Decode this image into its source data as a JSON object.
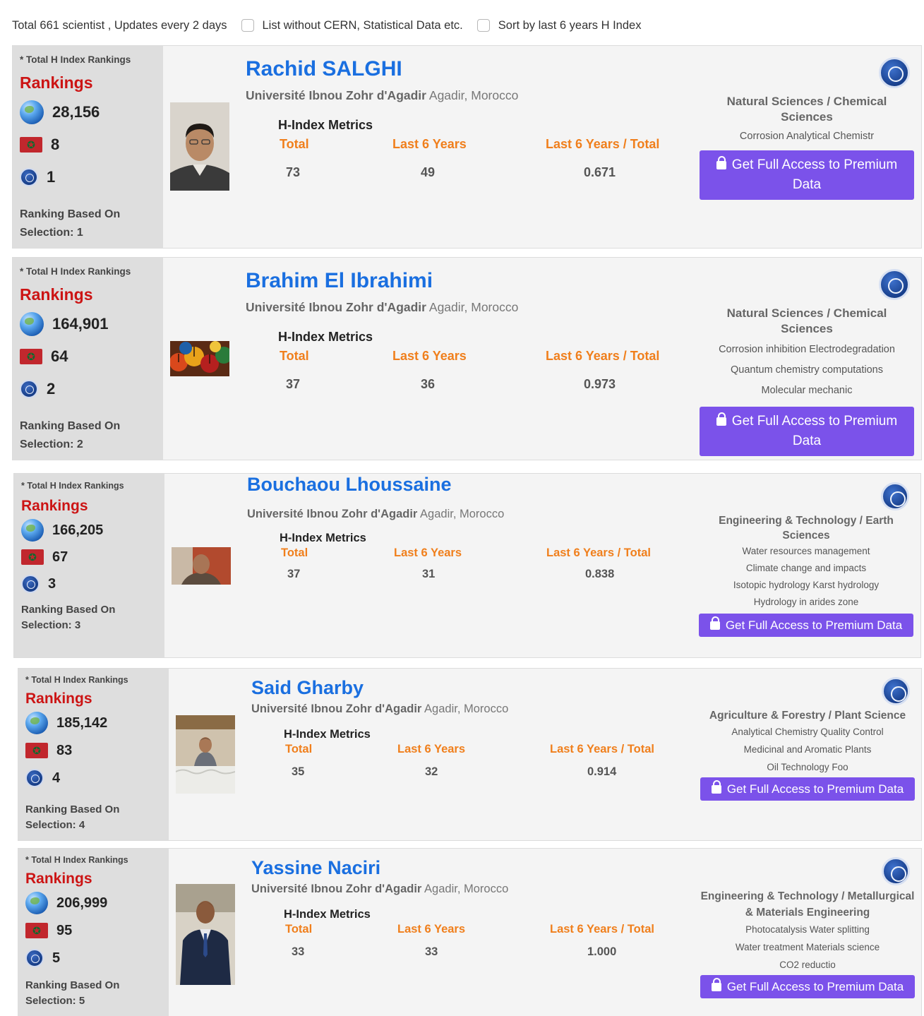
{
  "topbar": {
    "summary": "Total 661 scientist , Updates every 2 days",
    "filter_cern": "List without CERN, Statistical Data etc.",
    "filter_sort": "Sort by last 6 years H Index"
  },
  "labels": {
    "total_rankings_caption": "* Total H Index Rankings",
    "rankings_title": "Rankings",
    "metrics_title": "H-Index Metrics",
    "col_total": "Total",
    "col_last6": "Last 6 Years",
    "col_ratio": "Last 6 Years / Total",
    "premium_button": "Get Full Access to Premium Data",
    "ranking_based_on": "Ranking Based On"
  },
  "scientists": [
    {
      "name": "Rachid SALGHI",
      "university": "Université Ibnou Zohr d'Agadir",
      "location": "Agadir, Morocco",
      "rank_world": "28,156",
      "rank_country": "8",
      "rank_university": "1",
      "selection": "Selection: 1",
      "h_total": "73",
      "h_last6": "49",
      "h_ratio": "0.671",
      "field": "Natural Sciences / Chemical Sciences",
      "topics": [
        "Corrosion  Analytical Chemistr"
      ]
    },
    {
      "name": "Brahim El Ibrahimi",
      "university": "Université Ibnou Zohr d'Agadir",
      "location": "Agadir, Morocco",
      "rank_world": "164,901",
      "rank_country": "64",
      "rank_university": "2",
      "selection": "Selection: 2",
      "h_total": "37",
      "h_last6": "36",
      "h_ratio": "0.973",
      "field": "Natural Sciences / Chemical Sciences",
      "topics": [
        "Corrosion inhibition  Electrodegradation",
        "Quantum chemistry computations",
        "Molecular mechanic"
      ]
    },
    {
      "name": "Bouchaou Lhoussaine",
      "university": "Université Ibnou Zohr d'Agadir",
      "location": "Agadir, Morocco",
      "rank_world": "166,205",
      "rank_country": "67",
      "rank_university": "3",
      "selection": "Selection: 3",
      "h_total": "37",
      "h_last6": "31",
      "h_ratio": "0.838",
      "field": "Engineering & Technology / Earth Sciences",
      "topics": [
        "Water resources management",
        "Climate change and impacts",
        "Isotopic hydrology  Karst hydrology",
        "Hydrology in arides zone"
      ]
    },
    {
      "name": "Said Gharby",
      "university": "Université Ibnou Zohr d'Agadir",
      "location": "Agadir, Morocco",
      "rank_world": "185,142",
      "rank_country": "83",
      "rank_university": "4",
      "selection": "Selection: 4",
      "h_total": "35",
      "h_last6": "32",
      "h_ratio": "0.914",
      "field": "Agriculture & Forestry / Plant Science",
      "topics": [
        "Analytical Chemistry  Quality Control",
        "Medicinal and Aromatic Plants",
        "Oil Technology  Foo"
      ]
    },
    {
      "name": "Yassine Naciri",
      "university": "Université Ibnou Zohr d'Agadir",
      "location": "Agadir, Morocco",
      "rank_world": "206,999",
      "rank_country": "95",
      "rank_university": "5",
      "selection": "Selection: 5",
      "h_total": "33",
      "h_last6": "33",
      "h_ratio": "1.000",
      "field": "Engineering & Technology / Metallurgical & Materials Engineering",
      "topics": [
        "Photocatalysis  Water splitting",
        "Water treatment  Materials science",
        "CO2 reductio"
      ]
    }
  ]
}
